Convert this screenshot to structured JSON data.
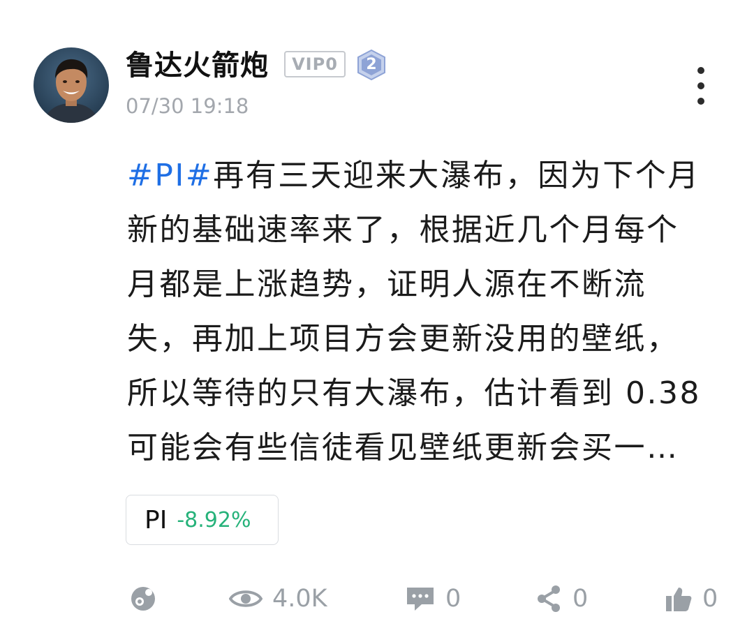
{
  "post": {
    "author": {
      "name": "鲁达火箭炮",
      "vip_label": "VIP0",
      "level": "2",
      "avatar_icon": "avatar-photo-icon"
    },
    "timestamp": "07/30 19:18",
    "content": {
      "hashtag": "#PI#",
      "lines": [
        "再有三天迎来大瀑布，因为下个月",
        "新的基础速率来了，根据近几个月每个",
        "月都是上涨趋势，证明人源在不断流",
        "失，再加上项目方会更新没用的壁纸，",
        "所以等待的只有大瀑布，估计看到 0.38",
        "可能会有些信徒看见壁纸更新会买一…"
      ]
    },
    "token": {
      "symbol": "PI",
      "change": "-8.92%",
      "change_color": "#26b27a"
    },
    "actions": {
      "repost_icon": "repost-icon",
      "views": "4.0K",
      "comments": "0",
      "shares": "0",
      "likes": "0"
    }
  },
  "colors": {
    "hashtag": "#1f6fe5",
    "secondary_text": "#a3a7ad",
    "icon_gray": "#9aa0a6",
    "level_badge": "#8ea3d6"
  }
}
